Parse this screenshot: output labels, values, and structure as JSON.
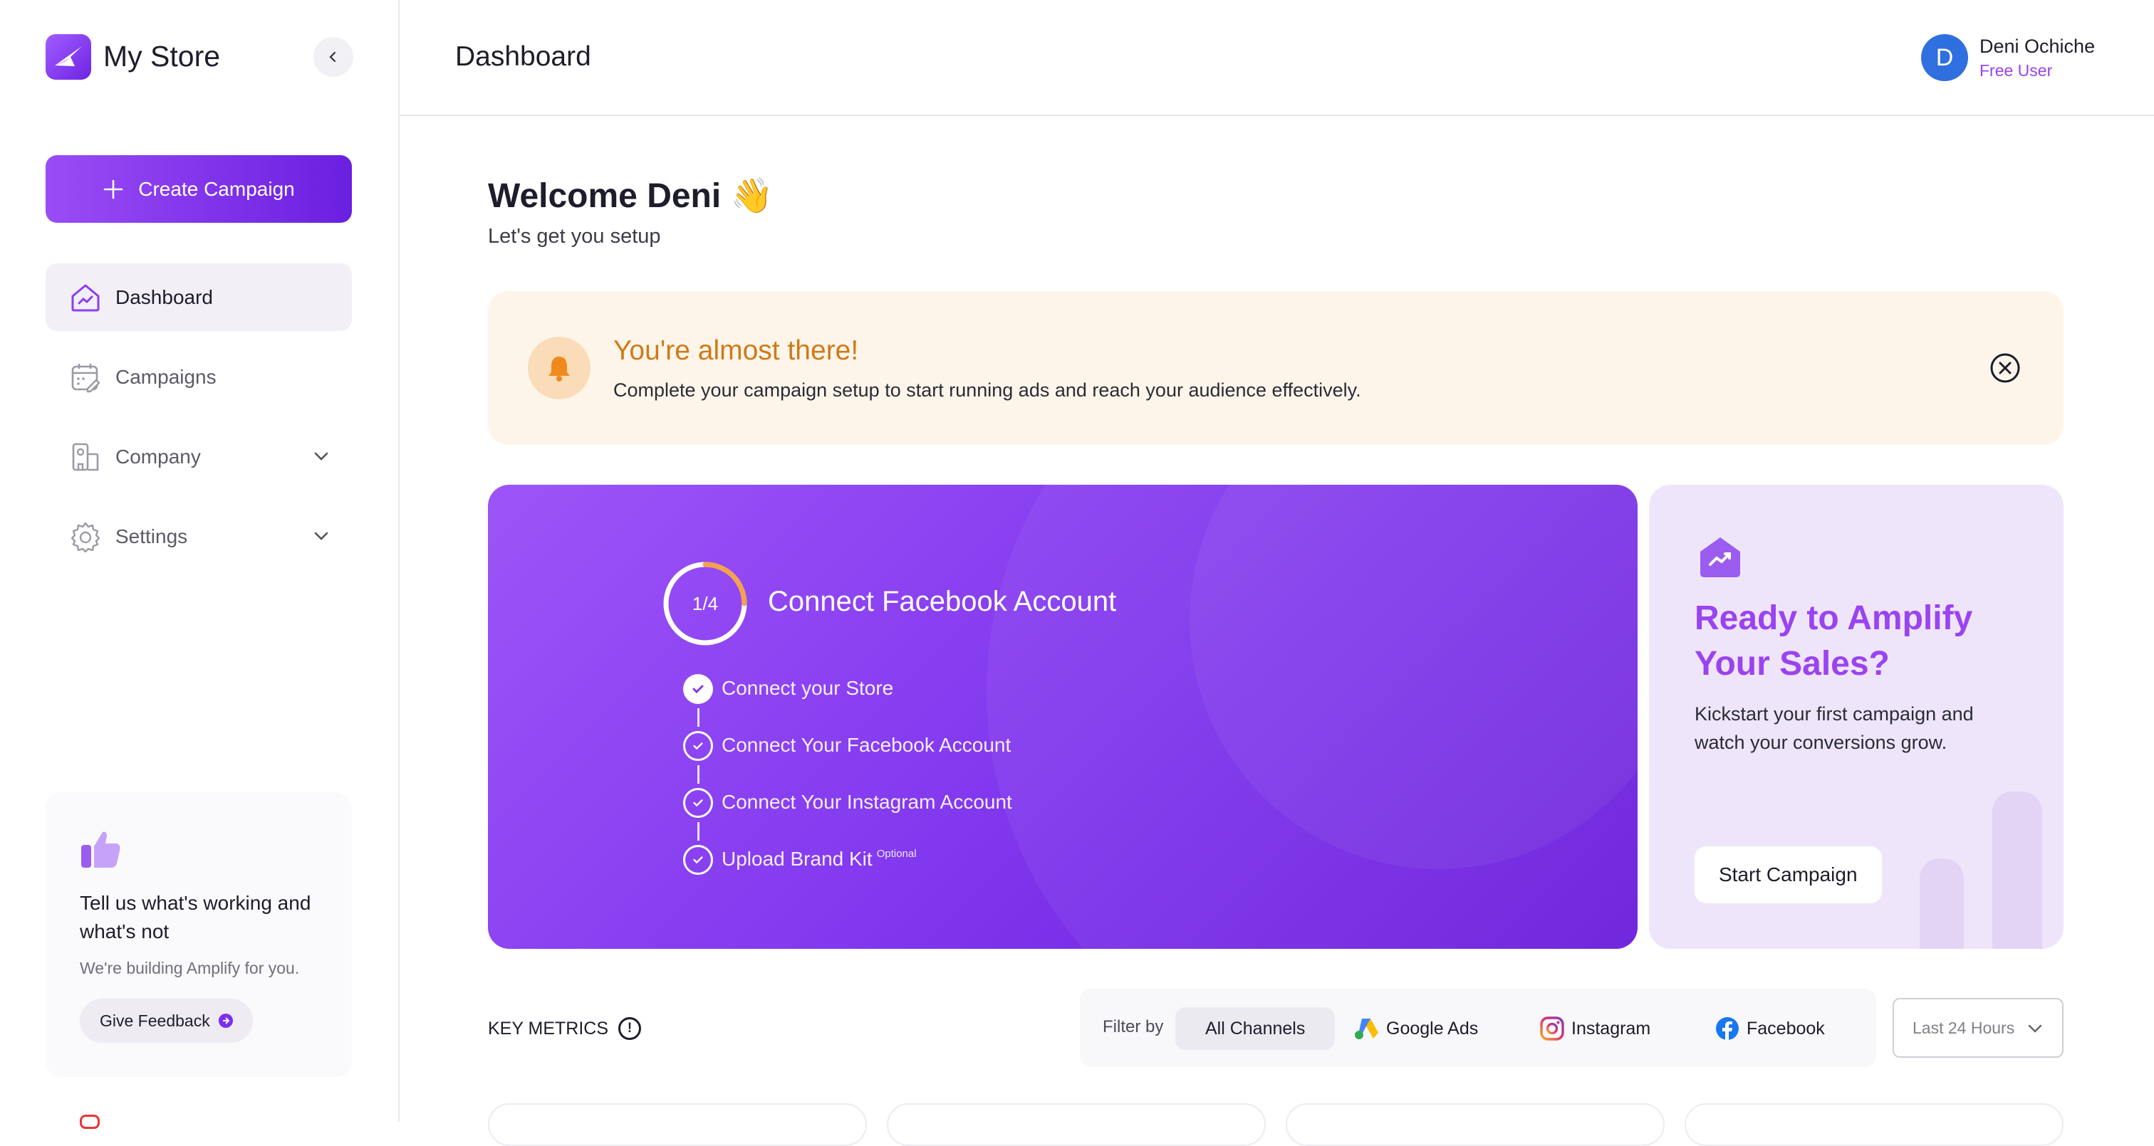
{
  "app": {
    "name": "My Store"
  },
  "sidebar": {
    "create_label": "Create Campaign",
    "items": [
      {
        "label": "Dashboard",
        "icon": "home-chart-icon",
        "active": true
      },
      {
        "label": "Campaigns",
        "icon": "calendar-edit-icon"
      },
      {
        "label": "Company",
        "icon": "building-icon",
        "expandable": true
      },
      {
        "label": "Settings",
        "icon": "gear-icon",
        "expandable": true
      }
    ],
    "feedback": {
      "title": "Tell us what's working and what's not",
      "subtitle": "We're building Amplify for you.",
      "button": "Give Feedback"
    }
  },
  "header": {
    "title": "Dashboard",
    "user": {
      "initial": "D",
      "name": "Deni Ochiche",
      "role": "Free User"
    }
  },
  "welcome": {
    "title": "Welcome Deni 👋",
    "subtitle": "Let's get you setup"
  },
  "alert": {
    "title": "You're almost there!",
    "text": "Complete your campaign setup to start running ads and reach your audience effectively."
  },
  "setup": {
    "progress_label": "1/4",
    "progress_fraction": 0.25,
    "title": "Connect Facebook Account",
    "steps": [
      {
        "label": "Connect your Store",
        "done": true
      },
      {
        "label": "Connect Your Facebook Account",
        "done": false
      },
      {
        "label": "Connect Your Instagram Account",
        "done": false
      },
      {
        "label": "Upload Brand Kit",
        "done": false,
        "note": "Optional"
      }
    ]
  },
  "promo": {
    "title": "Ready to Amplify Your Sales?",
    "text": "Kickstart your first campaign and watch your conversions grow.",
    "button": "Start Campaign"
  },
  "metrics": {
    "label": "KEY METRICS",
    "filter_label": "Filter by",
    "channels": [
      "All Channels",
      "Google Ads",
      "Instagram",
      "Facebook"
    ],
    "selected_channel": "All Channels",
    "range": "Last 24 Hours"
  },
  "colors": {
    "accent": "#8238ee",
    "promo_title": "#9a43f0",
    "alert_title": "#cf7a18"
  }
}
